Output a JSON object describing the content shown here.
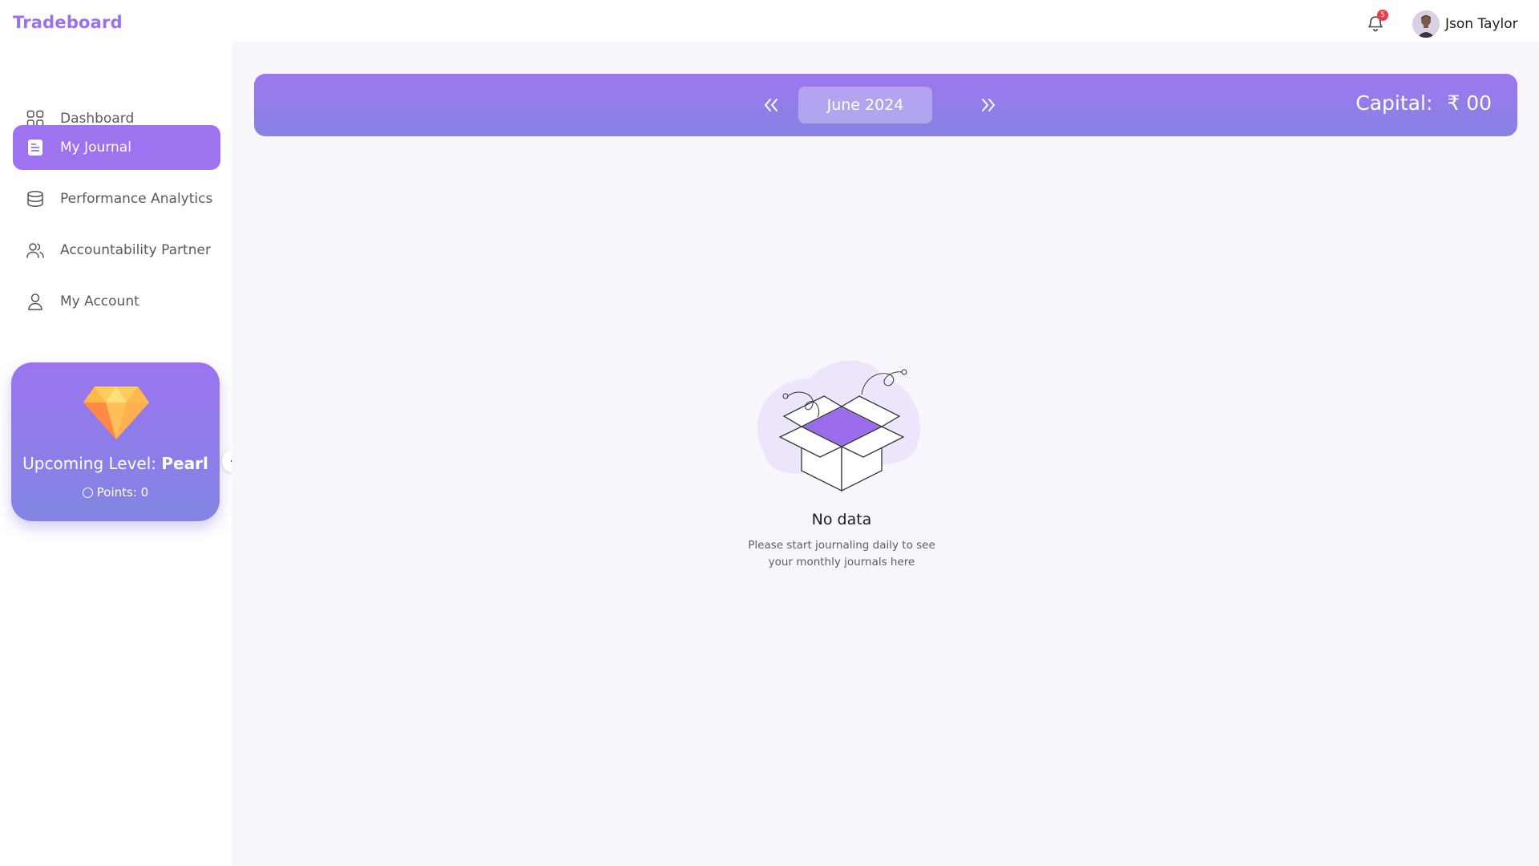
{
  "app": {
    "brand": "Tradeboard"
  },
  "header": {
    "notifications_count": "5",
    "user_name": "Json Taylor"
  },
  "sidebar": {
    "items": [
      {
        "label": "Dashboard",
        "icon": "grid-icon",
        "active": false
      },
      {
        "label": "My Journal",
        "icon": "journal-icon",
        "active": true
      },
      {
        "label": "Performance Analytics",
        "icon": "database-icon",
        "active": false
      },
      {
        "label": "Accountability Partner",
        "icon": "users-icon",
        "active": false
      },
      {
        "label": "My Account",
        "icon": "user-icon",
        "active": false
      }
    ],
    "level_card": {
      "label": "Upcoming Level:",
      "level": "Pearl",
      "points": "Points: 0"
    }
  },
  "main": {
    "month": "June 2024",
    "capital_label": "Capital:",
    "capital_currency": "₹",
    "capital_value": "00",
    "empty": {
      "title": "No data",
      "description": "Please start journaling daily to see your monthly journals here"
    }
  },
  "colors": {
    "accent": "#9f72ef",
    "accent_end": "#8683e3",
    "badge": "#ee3b4a",
    "main_bg": "#f8f6fc"
  }
}
